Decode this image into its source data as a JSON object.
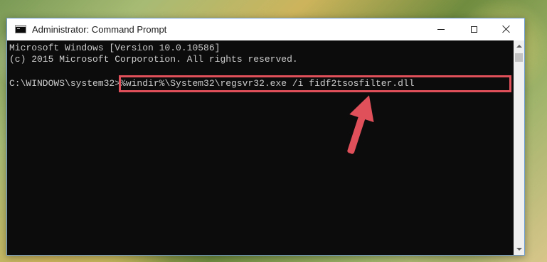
{
  "window": {
    "title": "Administrator: Command Prompt",
    "icon": "console-icon"
  },
  "controls": {
    "minimize": "minimize-icon",
    "maximize": "maximize-icon",
    "close": "close-icon"
  },
  "console": {
    "line1": "Microsoft Windows [Version 10.0.10586]",
    "line2": "(c) 2015 Microsoft Corporotion. All rights reserved.",
    "prompt": "C:\\WINDOWS\\system32>",
    "command": "%windir%\\System32\\regsvr32.exe /i fidf2tsosfilter.dll"
  },
  "annotation": {
    "highlight_color": "#e0505a",
    "arrow_color": "#e0505a"
  }
}
